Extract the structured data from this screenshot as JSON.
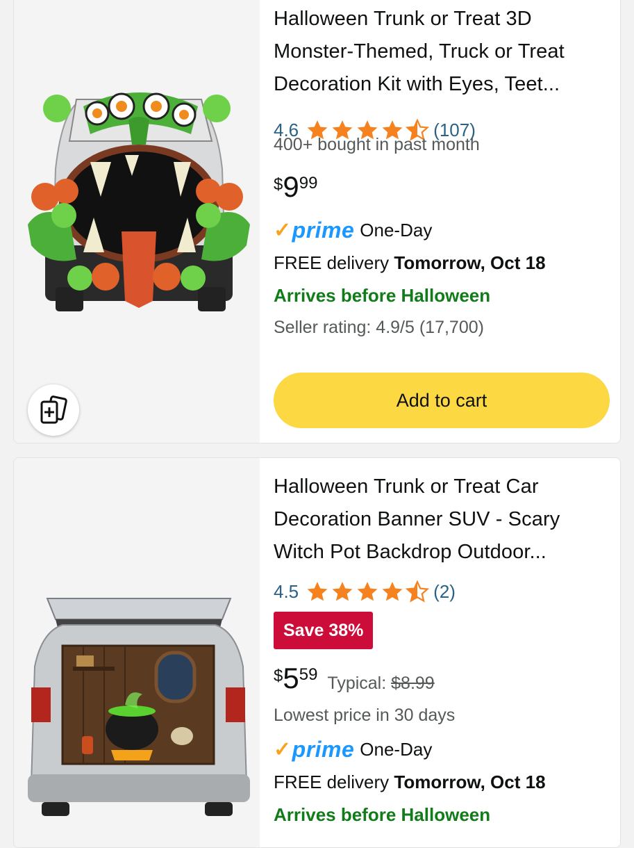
{
  "products": [
    {
      "title": "Halloween Trunk or Treat 3D Monster-Themed, Truck or Treat Decoration Kit with Eyes, Teet...",
      "rating": "4.6",
      "stars_filled": 4.5,
      "rating_count": "(107)",
      "bought": "400+ bought in past month",
      "price_symbol": "$",
      "price_whole": "9",
      "price_fraction": "99",
      "prime_label": "prime",
      "prime_tier": "One-Day",
      "delivery_prefix": "FREE delivery",
      "delivery_date": "Tomorrow, Oct 18",
      "arrives": "Arrives before Halloween",
      "seller_rating": "Seller rating: 4.9/5 (17,700)",
      "add_to_cart": "Add to cart",
      "image_icon": "monster-trunk-decoration-image"
    },
    {
      "title": "Halloween Trunk or Treat Car Decoration Banner SUV - Scary Witch Pot Backdrop Outdoor...",
      "rating": "4.5",
      "stars_filled": 4.5,
      "rating_count": "(2)",
      "save_badge": "Save 38%",
      "price_symbol": "$",
      "price_whole": "5",
      "price_fraction": "59",
      "typical_label": "Typical:",
      "typical_price": "$8.99",
      "lowest_price": "Lowest price in 30 days",
      "prime_label": "prime",
      "prime_tier": "One-Day",
      "delivery_prefix": "FREE delivery",
      "delivery_date": "Tomorrow, Oct 18",
      "arrives": "Arrives before Halloween",
      "image_icon": "witch-pot-car-banner-image"
    }
  ],
  "colors": {
    "star": "#f5821f",
    "link_blue": "#2a6287",
    "prime_blue": "#1a98ff",
    "arrives_green": "#127c1a",
    "cart_yellow": "#fcd843",
    "save_red": "#cc0c39"
  },
  "compare_icon": "add-to-compare-icon"
}
